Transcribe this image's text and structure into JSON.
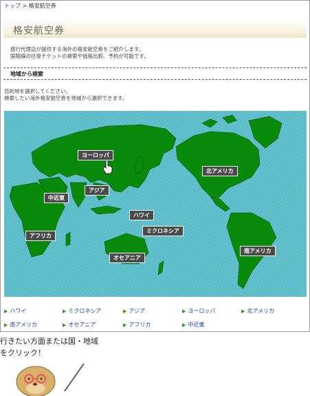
{
  "breadcrumb": {
    "home": "トップ",
    "separator": ">",
    "current": "格安航空券"
  },
  "page_title": "格安航空券",
  "intro": [
    "旅行代理店が提供する海外の格安航空券をご紹介します。",
    "国際線の往復チケットの検索や価格比較、予約が可能です。"
  ],
  "section_heading": "地域から検索",
  "description": [
    "目的地を選択してください。",
    "検索したい海外格安航空券を地域から選択できます。"
  ],
  "map_regions": {
    "europe": "ヨーロッパ",
    "north_america": "北アメリカ",
    "asia": "アジア",
    "middle_east": "中近東",
    "hawaii": "ハワイ",
    "micronesia": "ミクロネシア",
    "africa": "アフリカ",
    "oceania": "オセアニア",
    "south_america": "南アメリカ"
  },
  "region_links": [
    "ハワイ",
    "ミクロネシア",
    "アジア",
    "ヨーロッパ",
    "北アメリカ",
    "南アメリカ",
    "オセアニア",
    "アフリカ",
    "中近東"
  ],
  "cta": [
    "行きたい方面または国・地域",
    "をクリック！"
  ],
  "colors": {
    "ocean": "#5bbcc8",
    "land": "#0a8a0a",
    "label_bg": "#4a4a4a",
    "link": "#1a3fb0"
  }
}
